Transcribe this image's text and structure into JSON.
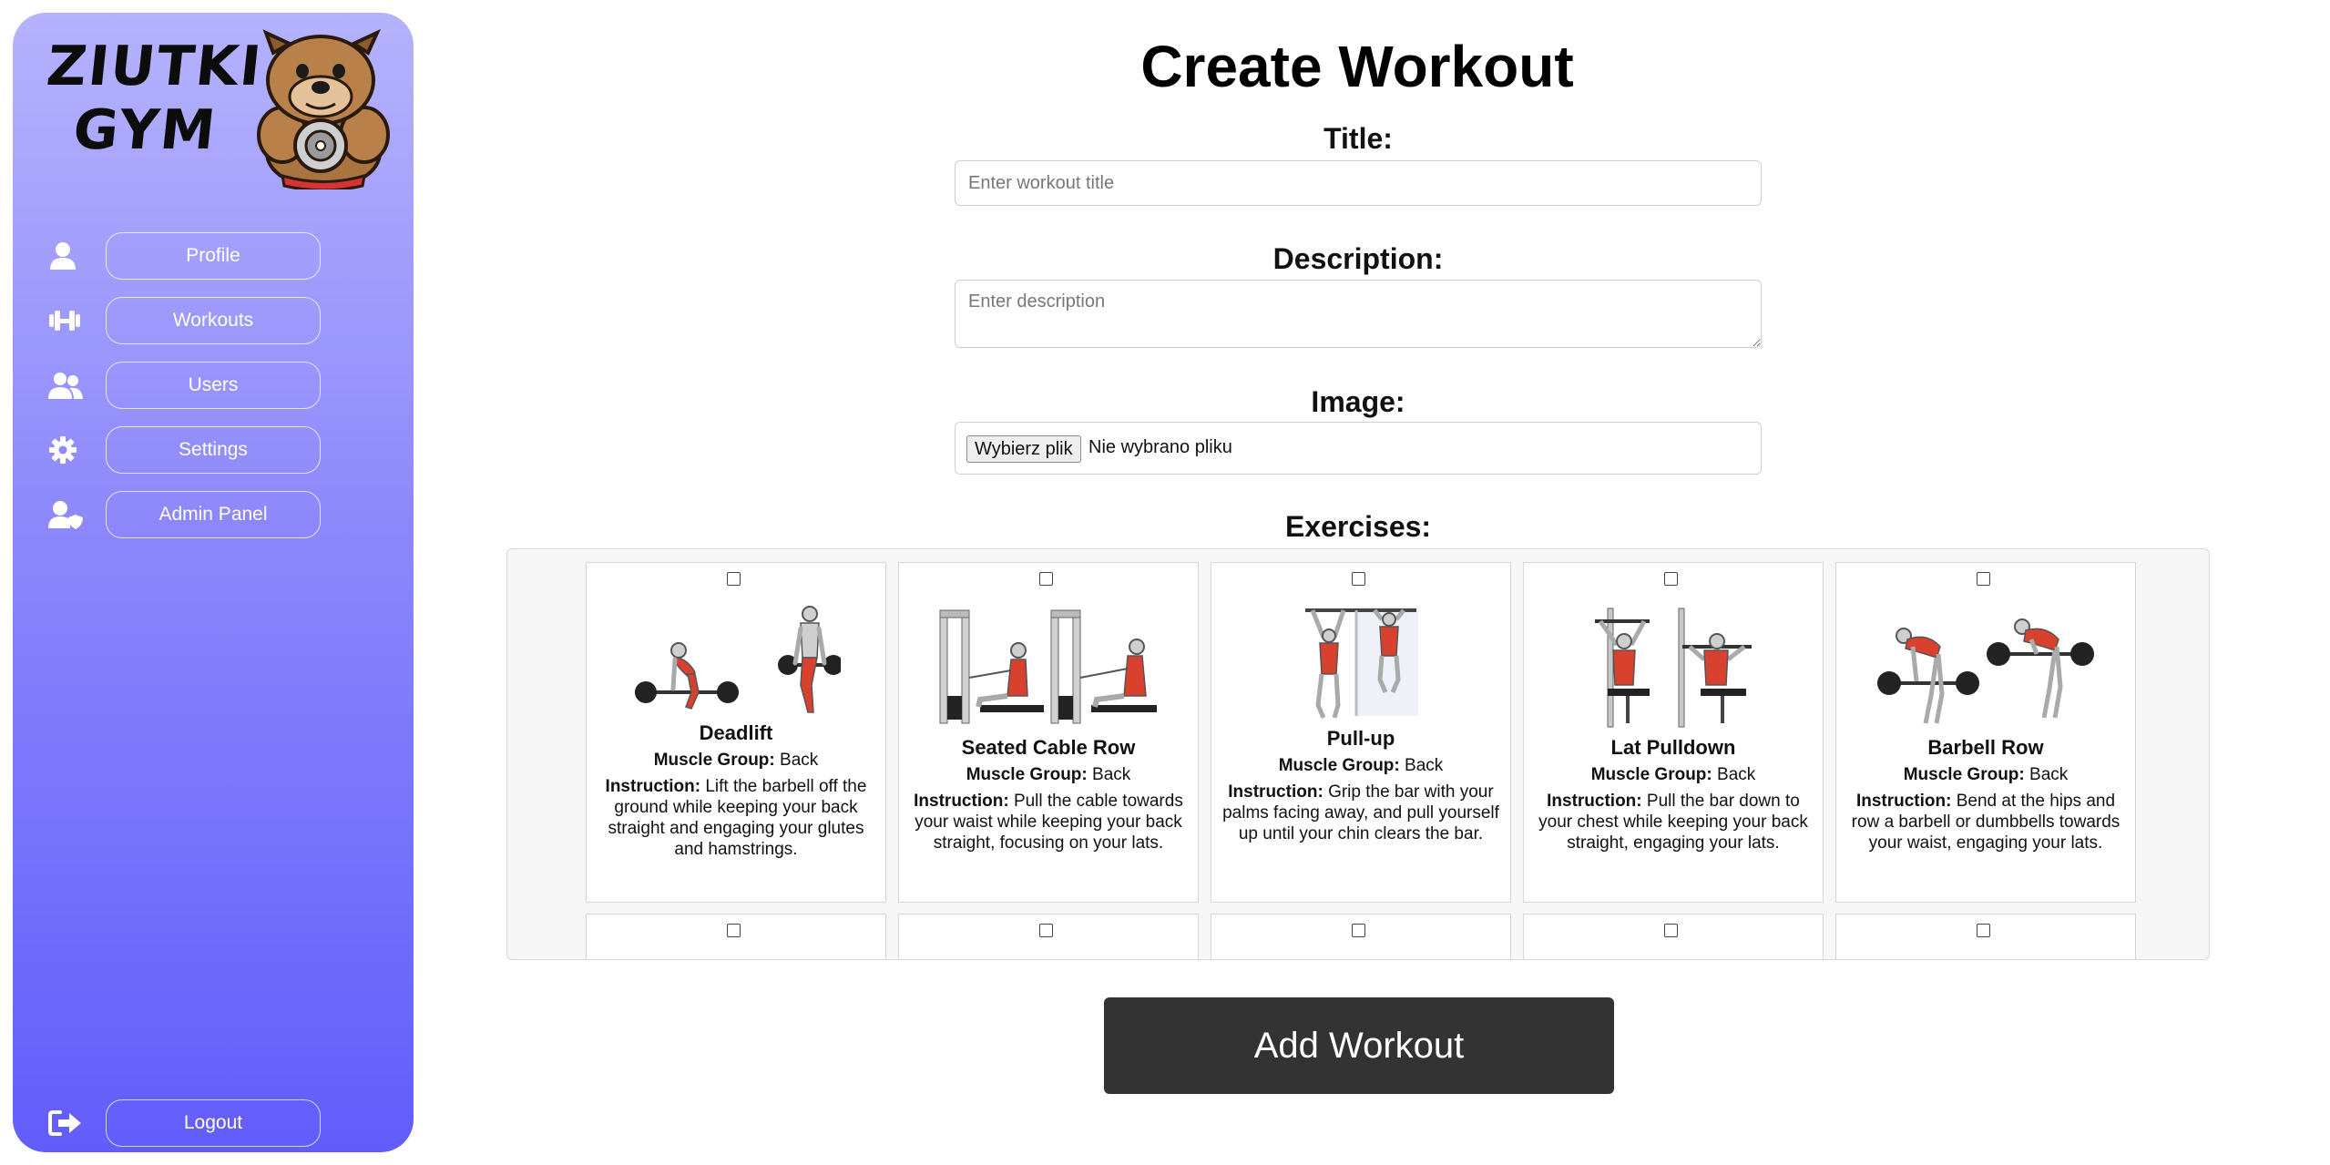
{
  "brand": {
    "name_line1": "ZIUTKI",
    "name_line2": "GYM",
    "mascot_icon": "bulldog-mascot-icon"
  },
  "sidebar": {
    "items": [
      {
        "label": "Profile",
        "icon": "user-icon"
      },
      {
        "label": "Workouts",
        "icon": "dumbbell-icon"
      },
      {
        "label": "Users",
        "icon": "users-icon"
      },
      {
        "label": "Settings",
        "icon": "gear-icon"
      },
      {
        "label": "Admin Panel",
        "icon": "user-shield-icon"
      }
    ],
    "logout": {
      "label": "Logout",
      "icon": "logout-icon"
    }
  },
  "form": {
    "page_title": "Create Workout",
    "title_label": "Title:",
    "title_placeholder": "Enter workout title",
    "description_label": "Description:",
    "description_placeholder": "Enter description",
    "image_label": "Image:",
    "file_button": "Wybierz plik",
    "file_status": "Nie wybrano pliku",
    "exercises_label": "Exercises:",
    "submit_label": "Add Workout"
  },
  "exercises": [
    {
      "name": "Deadlift",
      "group_label": "Muscle Group:",
      "group": "Back",
      "instr_label": "Instruction:",
      "instruction": "Lift the barbell off the ground while keeping your back straight and engaging your glutes and hamstrings."
    },
    {
      "name": "Seated Cable Row",
      "group_label": "Muscle Group:",
      "group": "Back",
      "instr_label": "Instruction:",
      "instruction": "Pull the cable towards your waist while keeping your back straight, focusing on your lats."
    },
    {
      "name": "Pull-up",
      "group_label": "Muscle Group:",
      "group": "Back",
      "instr_label": "Instruction:",
      "instruction": "Grip the bar with your palms facing away, and pull yourself up until your chin clears the bar."
    },
    {
      "name": "Lat Pulldown",
      "group_label": "Muscle Group:",
      "group": "Back",
      "instr_label": "Instruction:",
      "instruction": "Pull the bar down to your chest while keeping your back straight, engaging your lats."
    },
    {
      "name": "Barbell Row",
      "group_label": "Muscle Group:",
      "group": "Back",
      "instr_label": "Instruction:",
      "instruction": "Bend at the hips and row a barbell or dumbbells towards your waist, engaging your lats."
    }
  ],
  "colors": {
    "sidebar_top": "#b5b3fd",
    "sidebar_bottom": "#625cfb",
    "button_dark": "#333333",
    "muscle": "#d9412f"
  }
}
